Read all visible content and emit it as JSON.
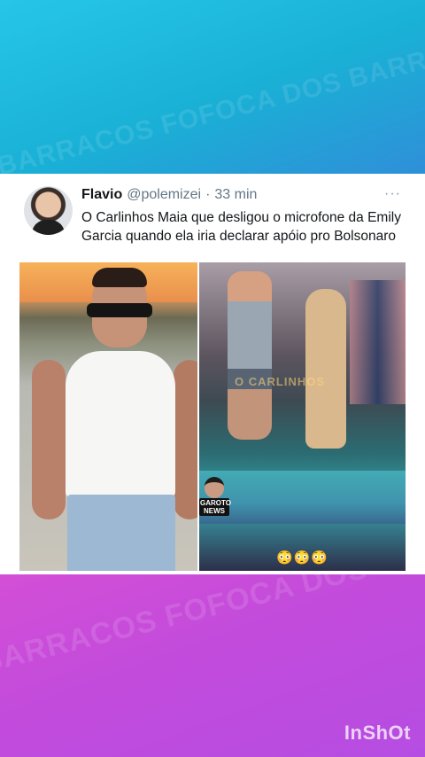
{
  "tweet": {
    "name": "Flavio",
    "handle": "@polemizei",
    "separator": "·",
    "time": "33 min",
    "more": "···",
    "text": "O Carlinhos Maia que desligou o microfone da Emily Garcia quando ela iria declarar  apóio pro Bolsonaro"
  },
  "media": {
    "right_watermark": "O CARLINHOS",
    "badge": "GAROTO NEWS",
    "emojis": "😳😳😳"
  },
  "background": {
    "watermark_text": "BARRACOS FOFOCA DOS BARRACOS FOFOCA DOS",
    "top_color": "#1ab0d6",
    "bottom_color": "#c24bdc"
  },
  "app_watermark": "InShOt"
}
